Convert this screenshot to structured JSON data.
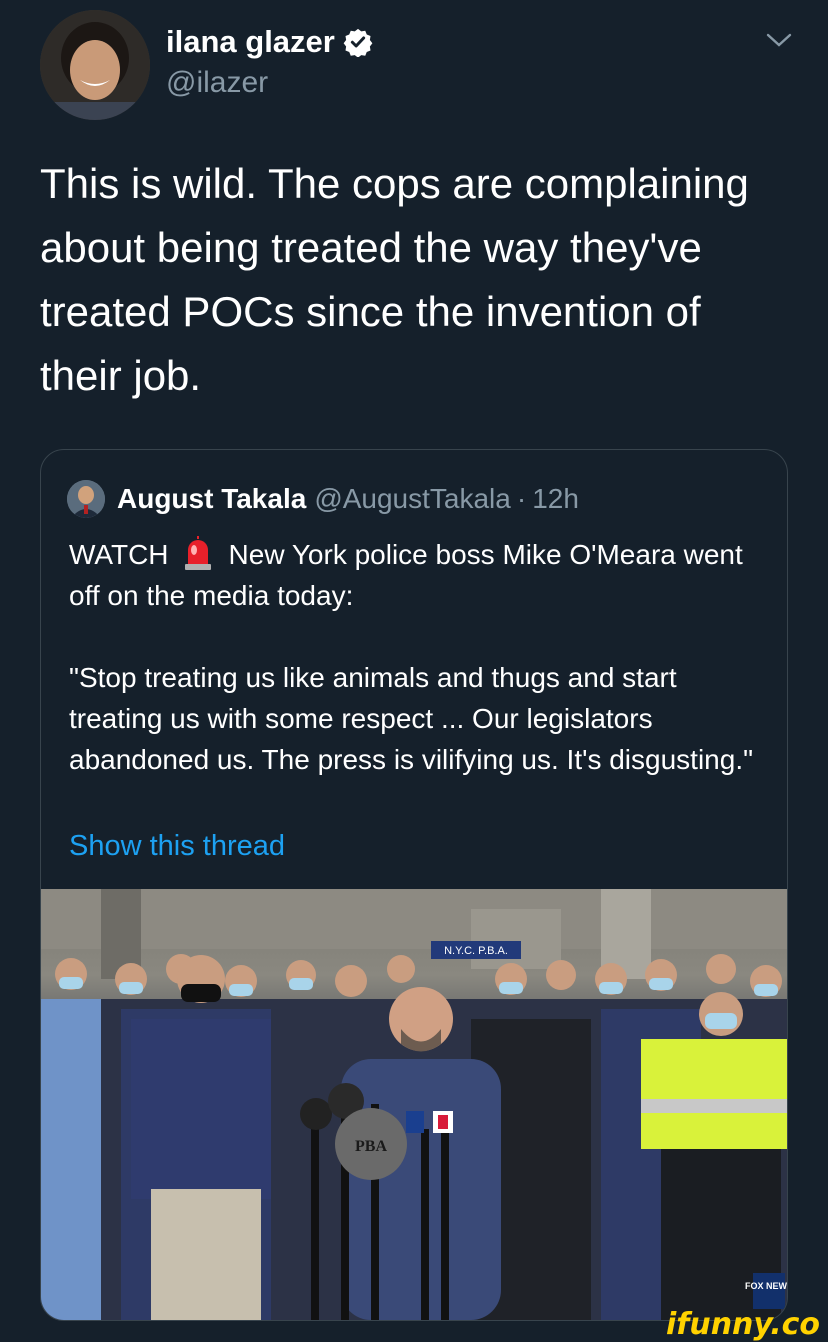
{
  "tweet": {
    "author_name": "ilana glazer",
    "author_handle": "@ilazer",
    "verified": true,
    "text": "This is wild. The cops are complaining about being treated the way they've treated POCs since the invention of their job."
  },
  "quote": {
    "author_name": "August Takala",
    "author_handle": "@AugustTakala",
    "separator": "·",
    "time": "12h",
    "watch_label": "WATCH",
    "line1_rest": "New York police boss Mike O'Meara went off on the media today:",
    "quote_text": "\"Stop treating us like animals and thugs and start treating us with some respect ... Our legislators abandoned us. The press is vilifying us. It's disgusting.\"",
    "show_thread": "Show this thread",
    "media_badge": "FOX NEWS",
    "podium_sign": "PBA",
    "banner_text": "N.Y.C. P.B.A."
  },
  "watermark": "ifunny.co",
  "colors": {
    "background": "#15202b",
    "link": "#1da1f2",
    "muted": "#8899a6",
    "border": "#38444d",
    "watermark": "#ffd200"
  },
  "icons": [
    "verified-badge-icon",
    "chevron-down-icon",
    "police-siren-emoji-icon"
  ]
}
